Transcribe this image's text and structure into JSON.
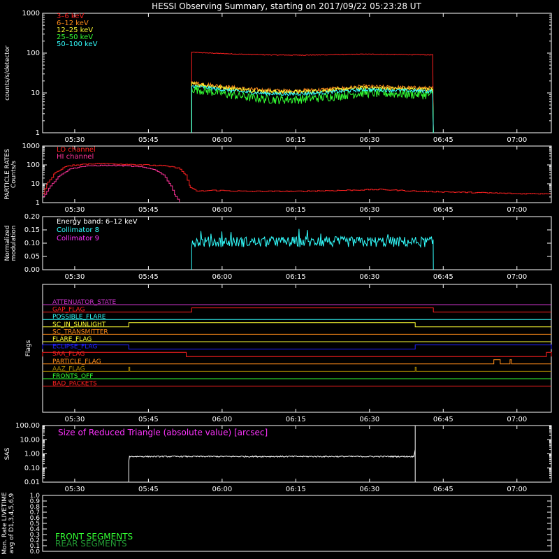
{
  "title": "HESSI Observing Summary, starting on 2017/09/22 05:23:28 UT",
  "time_axis": {
    "start_min": 323.47,
    "end_min": 427.0,
    "ticks": [
      {
        "t": 330,
        "label": "05:30"
      },
      {
        "t": 345,
        "label": "05:45"
      },
      {
        "t": 360,
        "label": "06:00"
      },
      {
        "t": 375,
        "label": "06:15"
      },
      {
        "t": 390,
        "label": "06:30"
      },
      {
        "t": 405,
        "label": "06:45"
      },
      {
        "t": 420,
        "label": "07:00"
      }
    ]
  },
  "chart_data": [
    {
      "type": "line",
      "panel": "count-rates",
      "ylabel": "counts/s/detector",
      "yscale": "log",
      "ylim": [
        1,
        1000
      ],
      "y_ticks": [
        "1",
        "10",
        "100",
        "1000"
      ],
      "series": [
        {
          "name": "3–6 keV",
          "color": "#ff2020",
          "t_on": 353.8,
          "t_off": 403.0,
          "start": 105,
          "end": 90,
          "mid_dip": 0.9,
          "noise": 0.02
        },
        {
          "name": "6–12 keV",
          "color": "#ff8c1a",
          "t_on": 353.8,
          "t_off": 403.0,
          "start": 18,
          "end": 13,
          "mid_dip": 0.7,
          "noise": 0.12
        },
        {
          "name": "12–25 keV",
          "color": "#ffff33",
          "t_on": 353.8,
          "t_off": 403.0,
          "start": 17,
          "end": 12,
          "mid_dip": 0.7,
          "noise": 0.12
        },
        {
          "name": "25–50 keV",
          "color": "#33ff33",
          "t_on": 353.8,
          "t_off": 403.0,
          "start": 13,
          "end": 9,
          "mid_dip": 0.6,
          "noise": 0.25
        },
        {
          "name": "50–100 keV",
          "color": "#33ffff",
          "t_on": 353.8,
          "t_off": 403.0,
          "start": 15,
          "end": 11,
          "mid_dip": 0.7,
          "noise": 0.1
        }
      ]
    },
    {
      "type": "line",
      "panel": "particle-rates",
      "ylabel": "PARTICLE RATES Counts/s",
      "yscale": "log",
      "ylim": [
        1,
        1000
      ],
      "y_ticks": [
        "1",
        "10",
        "100",
        "1000"
      ],
      "series": [
        {
          "name": "LO channel",
          "color": "#ff2020",
          "points": [
            [
              323.5,
              3
            ],
            [
              324.5,
              12
            ],
            [
              326,
              40
            ],
            [
              328,
              80
            ],
            [
              330,
              100
            ],
            [
              333,
              115
            ],
            [
              336,
              118
            ],
            [
              340,
              110
            ],
            [
              344,
              100
            ],
            [
              348,
              90
            ],
            [
              351,
              70
            ],
            [
              352.5,
              30
            ],
            [
              353.5,
              6
            ],
            [
              355,
              4
            ],
            [
              358,
              4.5
            ],
            [
              365,
              4
            ],
            [
              375,
              4
            ],
            [
              385,
              4.5
            ],
            [
              392,
              5
            ],
            [
              400,
              4
            ],
            [
              410,
              3.5
            ],
            [
              420,
              3
            ],
            [
              427,
              3
            ]
          ]
        },
        {
          "name": "HI channel",
          "color": "#ff3399",
          "points": [
            [
              323.5,
              2
            ],
            [
              325,
              8
            ],
            [
              327,
              30
            ],
            [
              329,
              60
            ],
            [
              331,
              80
            ],
            [
              334,
              92
            ],
            [
              337,
              95
            ],
            [
              340,
              90
            ],
            [
              343,
              80
            ],
            [
              346,
              60
            ],
            [
              348,
              30
            ],
            [
              349.5,
              8
            ],
            [
              350.5,
              2
            ],
            [
              351.5,
              1
            ]
          ]
        }
      ]
    },
    {
      "type": "line",
      "panel": "modulation",
      "ylabel": "Normalized modulation",
      "ylim": [
        0.0,
        0.2
      ],
      "y_ticks": [
        "0.00",
        "0.05",
        "0.10",
        "0.15",
        "0.20"
      ],
      "legend_title": "Energy band: 6–12 keV",
      "series": [
        {
          "name": "Collimator 8",
          "color": "#33ffff",
          "t_on": 353.8,
          "t_off": 403.0,
          "mean": 0.105,
          "noise": 0.02
        },
        {
          "name": "Collimator 9",
          "color": "#ff33ff",
          "t_on": 353.8,
          "t_off": 403.0,
          "mean": 0.1,
          "noise": 0.0
        }
      ]
    },
    {
      "type": "line",
      "panel": "sas",
      "ylabel": "SAS",
      "yscale": "log",
      "ylim": [
        0.01,
        100
      ],
      "y_ticks": [
        "0.01",
        "0.10",
        "1.00",
        "10.00",
        "100.00"
      ],
      "legend_title": "Size of Reduced Triangle (absolute value) [arcsec]",
      "series": [
        {
          "name": "SAS",
          "color": "#ffffff",
          "t_on": 341.0,
          "t_off": 399.3,
          "mean": 0.65,
          "noise": 0.1
        }
      ]
    },
    {
      "type": "line",
      "panel": "monitor-livetime",
      "ylabel": "Mon. Rate LIVETIME avg of D1,3,4,5,6,9",
      "ylim": [
        0.0,
        1.0
      ],
      "y_ticks": [
        "0.0",
        "0.1",
        "0.2",
        "0.3",
        "0.4",
        "0.5",
        "0.6",
        "0.7",
        "0.8",
        "0.9",
        "1.0"
      ],
      "series": [
        {
          "name": "FRONT SEGMENTS",
          "color": "#33ff33"
        },
        {
          "name": "REAR SEGMENTS",
          "color": "#229933"
        }
      ]
    }
  ],
  "flags": {
    "ylabel": "Flags",
    "items": [
      {
        "name": "ATTENUATOR_STATE",
        "color": "#cc33cc",
        "segments": []
      },
      {
        "name": "GAP_FLAG",
        "color": "#ff2020",
        "segments": [
          [
            353.8,
            403.0
          ]
        ]
      },
      {
        "name": "POSSIBLE_FLARE",
        "color": "#33ffff",
        "segments": []
      },
      {
        "name": "SC_IN_SUNLIGHT",
        "color": "#ffff33",
        "segments": [
          [
            341.0,
            427.0
          ]
        ],
        "inverse": [
          399.3,
          427.0
        ]
      },
      {
        "name": "SC_TRANSMITTER",
        "color": "#ff8c1a",
        "segments": []
      },
      {
        "name": "FLARE_FLAG",
        "color": "#ffff33",
        "segments": []
      },
      {
        "name": "ECLIPSE_FLAG",
        "color": "#2222ff",
        "segments": [
          [
            323.47,
            341.0
          ],
          [
            399.3,
            427.0
          ]
        ]
      },
      {
        "name": "SAA_FLAG",
        "color": "#ff2020",
        "segments": [
          [
            323.47,
            352.7
          ],
          [
            426.0,
            427.0
          ]
        ]
      },
      {
        "name": "PARTICLE_FLAG",
        "color": "#ff8c1a",
        "segments": [
          [
            415.3,
            416.6
          ],
          [
            418.6,
            418.9
          ]
        ]
      },
      {
        "name": "AAZ_FLAG",
        "color": "#aa8800",
        "segments": [
          [
            341.0,
            341.2
          ],
          [
            399.3,
            399.5
          ]
        ]
      },
      {
        "name": "FRONTS_OFF",
        "color": "#33ff33",
        "segments": []
      },
      {
        "name": "BAD_PACKETS",
        "color": "#ff2020",
        "segments": []
      }
    ]
  }
}
